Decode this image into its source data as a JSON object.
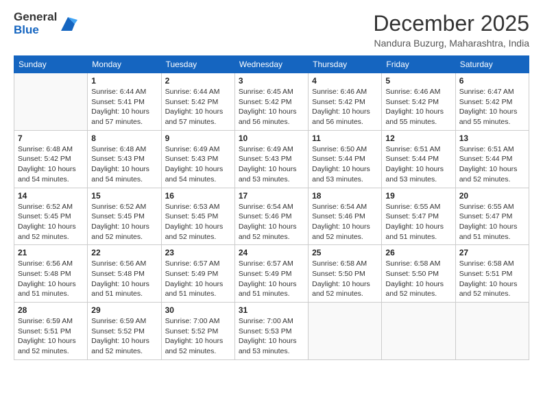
{
  "header": {
    "logo": {
      "line1": "General",
      "line2": "Blue"
    },
    "title": "December 2025",
    "location": "Nandura Buzurg, Maharashtra, India"
  },
  "calendar": {
    "weekdays": [
      "Sunday",
      "Monday",
      "Tuesday",
      "Wednesday",
      "Thursday",
      "Friday",
      "Saturday"
    ],
    "weeks": [
      [
        {
          "day": "",
          "info": ""
        },
        {
          "day": "1",
          "info": "Sunrise: 6:44 AM\nSunset: 5:41 PM\nDaylight: 10 hours\nand 57 minutes."
        },
        {
          "day": "2",
          "info": "Sunrise: 6:44 AM\nSunset: 5:42 PM\nDaylight: 10 hours\nand 57 minutes."
        },
        {
          "day": "3",
          "info": "Sunrise: 6:45 AM\nSunset: 5:42 PM\nDaylight: 10 hours\nand 56 minutes."
        },
        {
          "day": "4",
          "info": "Sunrise: 6:46 AM\nSunset: 5:42 PM\nDaylight: 10 hours\nand 56 minutes."
        },
        {
          "day": "5",
          "info": "Sunrise: 6:46 AM\nSunset: 5:42 PM\nDaylight: 10 hours\nand 55 minutes."
        },
        {
          "day": "6",
          "info": "Sunrise: 6:47 AM\nSunset: 5:42 PM\nDaylight: 10 hours\nand 55 minutes."
        }
      ],
      [
        {
          "day": "7",
          "info": "Sunrise: 6:48 AM\nSunset: 5:42 PM\nDaylight: 10 hours\nand 54 minutes."
        },
        {
          "day": "8",
          "info": "Sunrise: 6:48 AM\nSunset: 5:43 PM\nDaylight: 10 hours\nand 54 minutes."
        },
        {
          "day": "9",
          "info": "Sunrise: 6:49 AM\nSunset: 5:43 PM\nDaylight: 10 hours\nand 54 minutes."
        },
        {
          "day": "10",
          "info": "Sunrise: 6:49 AM\nSunset: 5:43 PM\nDaylight: 10 hours\nand 53 minutes."
        },
        {
          "day": "11",
          "info": "Sunrise: 6:50 AM\nSunset: 5:44 PM\nDaylight: 10 hours\nand 53 minutes."
        },
        {
          "day": "12",
          "info": "Sunrise: 6:51 AM\nSunset: 5:44 PM\nDaylight: 10 hours\nand 53 minutes."
        },
        {
          "day": "13",
          "info": "Sunrise: 6:51 AM\nSunset: 5:44 PM\nDaylight: 10 hours\nand 52 minutes."
        }
      ],
      [
        {
          "day": "14",
          "info": "Sunrise: 6:52 AM\nSunset: 5:45 PM\nDaylight: 10 hours\nand 52 minutes."
        },
        {
          "day": "15",
          "info": "Sunrise: 6:52 AM\nSunset: 5:45 PM\nDaylight: 10 hours\nand 52 minutes."
        },
        {
          "day": "16",
          "info": "Sunrise: 6:53 AM\nSunset: 5:45 PM\nDaylight: 10 hours\nand 52 minutes."
        },
        {
          "day": "17",
          "info": "Sunrise: 6:54 AM\nSunset: 5:46 PM\nDaylight: 10 hours\nand 52 minutes."
        },
        {
          "day": "18",
          "info": "Sunrise: 6:54 AM\nSunset: 5:46 PM\nDaylight: 10 hours\nand 52 minutes."
        },
        {
          "day": "19",
          "info": "Sunrise: 6:55 AM\nSunset: 5:47 PM\nDaylight: 10 hours\nand 51 minutes."
        },
        {
          "day": "20",
          "info": "Sunrise: 6:55 AM\nSunset: 5:47 PM\nDaylight: 10 hours\nand 51 minutes."
        }
      ],
      [
        {
          "day": "21",
          "info": "Sunrise: 6:56 AM\nSunset: 5:48 PM\nDaylight: 10 hours\nand 51 minutes."
        },
        {
          "day": "22",
          "info": "Sunrise: 6:56 AM\nSunset: 5:48 PM\nDaylight: 10 hours\nand 51 minutes."
        },
        {
          "day": "23",
          "info": "Sunrise: 6:57 AM\nSunset: 5:49 PM\nDaylight: 10 hours\nand 51 minutes."
        },
        {
          "day": "24",
          "info": "Sunrise: 6:57 AM\nSunset: 5:49 PM\nDaylight: 10 hours\nand 51 minutes."
        },
        {
          "day": "25",
          "info": "Sunrise: 6:58 AM\nSunset: 5:50 PM\nDaylight: 10 hours\nand 52 minutes."
        },
        {
          "day": "26",
          "info": "Sunrise: 6:58 AM\nSunset: 5:50 PM\nDaylight: 10 hours\nand 52 minutes."
        },
        {
          "day": "27",
          "info": "Sunrise: 6:58 AM\nSunset: 5:51 PM\nDaylight: 10 hours\nand 52 minutes."
        }
      ],
      [
        {
          "day": "28",
          "info": "Sunrise: 6:59 AM\nSunset: 5:51 PM\nDaylight: 10 hours\nand 52 minutes."
        },
        {
          "day": "29",
          "info": "Sunrise: 6:59 AM\nSunset: 5:52 PM\nDaylight: 10 hours\nand 52 minutes."
        },
        {
          "day": "30",
          "info": "Sunrise: 7:00 AM\nSunset: 5:52 PM\nDaylight: 10 hours\nand 52 minutes."
        },
        {
          "day": "31",
          "info": "Sunrise: 7:00 AM\nSunset: 5:53 PM\nDaylight: 10 hours\nand 53 minutes."
        },
        {
          "day": "",
          "info": ""
        },
        {
          "day": "",
          "info": ""
        },
        {
          "day": "",
          "info": ""
        }
      ]
    ]
  }
}
